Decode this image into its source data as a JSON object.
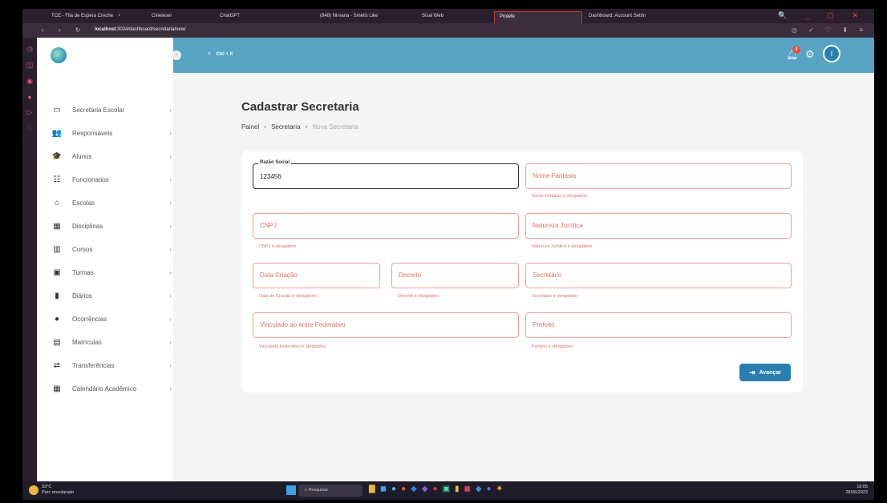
{
  "browser": {
    "tabs": [
      {
        "label": "TCE - Fila de Espera Creche",
        "active": false
      },
      {
        "label": "Cineleser",
        "active": false
      },
      {
        "label": "ChatGPT",
        "active": false
      },
      {
        "label": "(848) Nirvana - Smells Like",
        "active": false
      },
      {
        "label": "Sisal Web",
        "active": false
      },
      {
        "label": "Proiefe",
        "active": true
      },
      {
        "label": "Dashboard: Account Settin",
        "active": false
      }
    ],
    "url_host": "localhost",
    "url_path": ":3034/dashboard/secretaria/new/"
  },
  "sidebar": {
    "items": [
      {
        "label": "Secretaria Escolar",
        "icon": "monitor-icon"
      },
      {
        "label": "Responsáveis",
        "icon": "people-icon"
      },
      {
        "label": "Alunos",
        "icon": "graduation-cap-icon"
      },
      {
        "label": "Funcionarios",
        "icon": "group-icon"
      },
      {
        "label": "Escolas",
        "icon": "school-icon"
      },
      {
        "label": "Disciplinas",
        "icon": "books-icon"
      },
      {
        "label": "Cursos",
        "icon": "library-icon"
      },
      {
        "label": "Turmas",
        "icon": "classroom-icon"
      },
      {
        "label": "Diários",
        "icon": "journal-icon"
      },
      {
        "label": "Ocorrências",
        "icon": "alert-icon"
      },
      {
        "label": "Matrículas",
        "icon": "enrollment-icon"
      },
      {
        "label": "Transferências",
        "icon": "transfer-icon"
      },
      {
        "label": "Calendário Acadêmico",
        "icon": "calendar-icon"
      }
    ]
  },
  "topbar": {
    "search_shortcut": "Ctrl + K",
    "notification_count": "4",
    "avatar_initial": "I"
  },
  "page": {
    "title": "Cadastrar Secretaria",
    "breadcrumb": [
      "Painel",
      "Secretaria",
      "Nova Secretaria"
    ]
  },
  "form": {
    "razao_social": {
      "label": "Razão Social",
      "value": "123456"
    },
    "nome_fantasia": {
      "placeholder": "Nome Fantasia",
      "error": "Nome Fantasia é obrigatório"
    },
    "cnpj": {
      "placeholder": "CNPJ",
      "error": "CNPJ é obrigatório"
    },
    "natureza_juridica": {
      "placeholder": "Natureza Jurídica",
      "error": "Natureza Jurídica é obrigatório"
    },
    "data_criacao": {
      "placeholder": "Data Criação",
      "error": "Data de Criação é obrigatório"
    },
    "decreto": {
      "placeholder": "Decreto",
      "error": "Decreto é obrigatório"
    },
    "secretario": {
      "placeholder": "Secretário",
      "error": "Secretário é obrigatório"
    },
    "vinculado": {
      "placeholder": "Vinculado ao entre Federativo",
      "error": "Vinculado Federativo é obrigatório"
    },
    "prefeito": {
      "placeholder": "Prefeito",
      "error": "Prefeito é obrigatório"
    },
    "submit_label": "Avançar"
  },
  "taskbar": {
    "temperature": "33°C",
    "weather": "Parc ensolarado",
    "search_label": "Pesquisar",
    "time": "16:05",
    "date": "28/06/2023"
  },
  "colors": {
    "accent": "#57a3c3",
    "primary_button": "#2a7fb1",
    "error": "#e07060"
  }
}
